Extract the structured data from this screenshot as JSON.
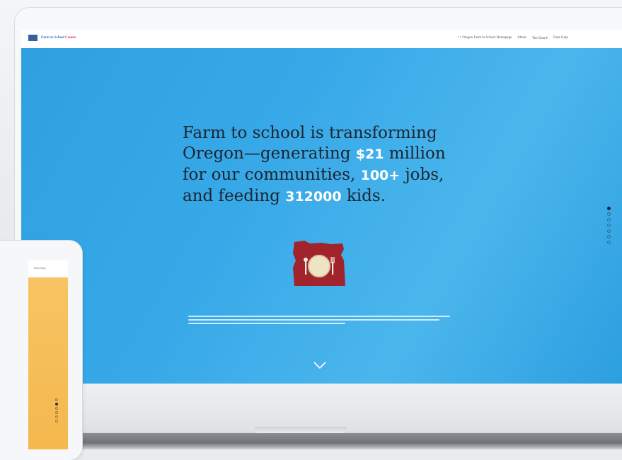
{
  "nav": {
    "logo": {
      "part1": "Farm to School",
      "part2": "Counts"
    },
    "links": [
      {
        "label": "<< Oregon Farm to School Homepage"
      },
      {
        "label": "About"
      },
      {
        "label": "The Data",
        "has_dropdown": true
      },
      {
        "label": "Data Gaps"
      }
    ]
  },
  "hero": {
    "line1": "Farm to school is transforming",
    "line2_pre": "Oregon—generating ",
    "money": "$21",
    "line2_post": " million",
    "line3_pre": "for our communities, ",
    "jobs": "100+",
    "line3_post": " jobs,",
    "line4_pre": "and feeding ",
    "kids": "312000",
    "line4_post": " kids."
  },
  "icons": {
    "oregon_map": "oregon-plate-icon",
    "scroll_down": "chevron-down-icon"
  },
  "dot_nav": {
    "count": 7,
    "active_index": 0
  },
  "tablet": {
    "nav_label": "Data Gaps",
    "dot_count": 6,
    "active_index": 1
  },
  "colors": {
    "hero_blue": "#38a9e8",
    "highlight": "#ffffff",
    "map_red": "#a1242d",
    "plate": "#efe3c6",
    "tablet_orange": "#f6bd55",
    "logo_blue": "#2f6fc7",
    "logo_pink": "#e0365e"
  }
}
